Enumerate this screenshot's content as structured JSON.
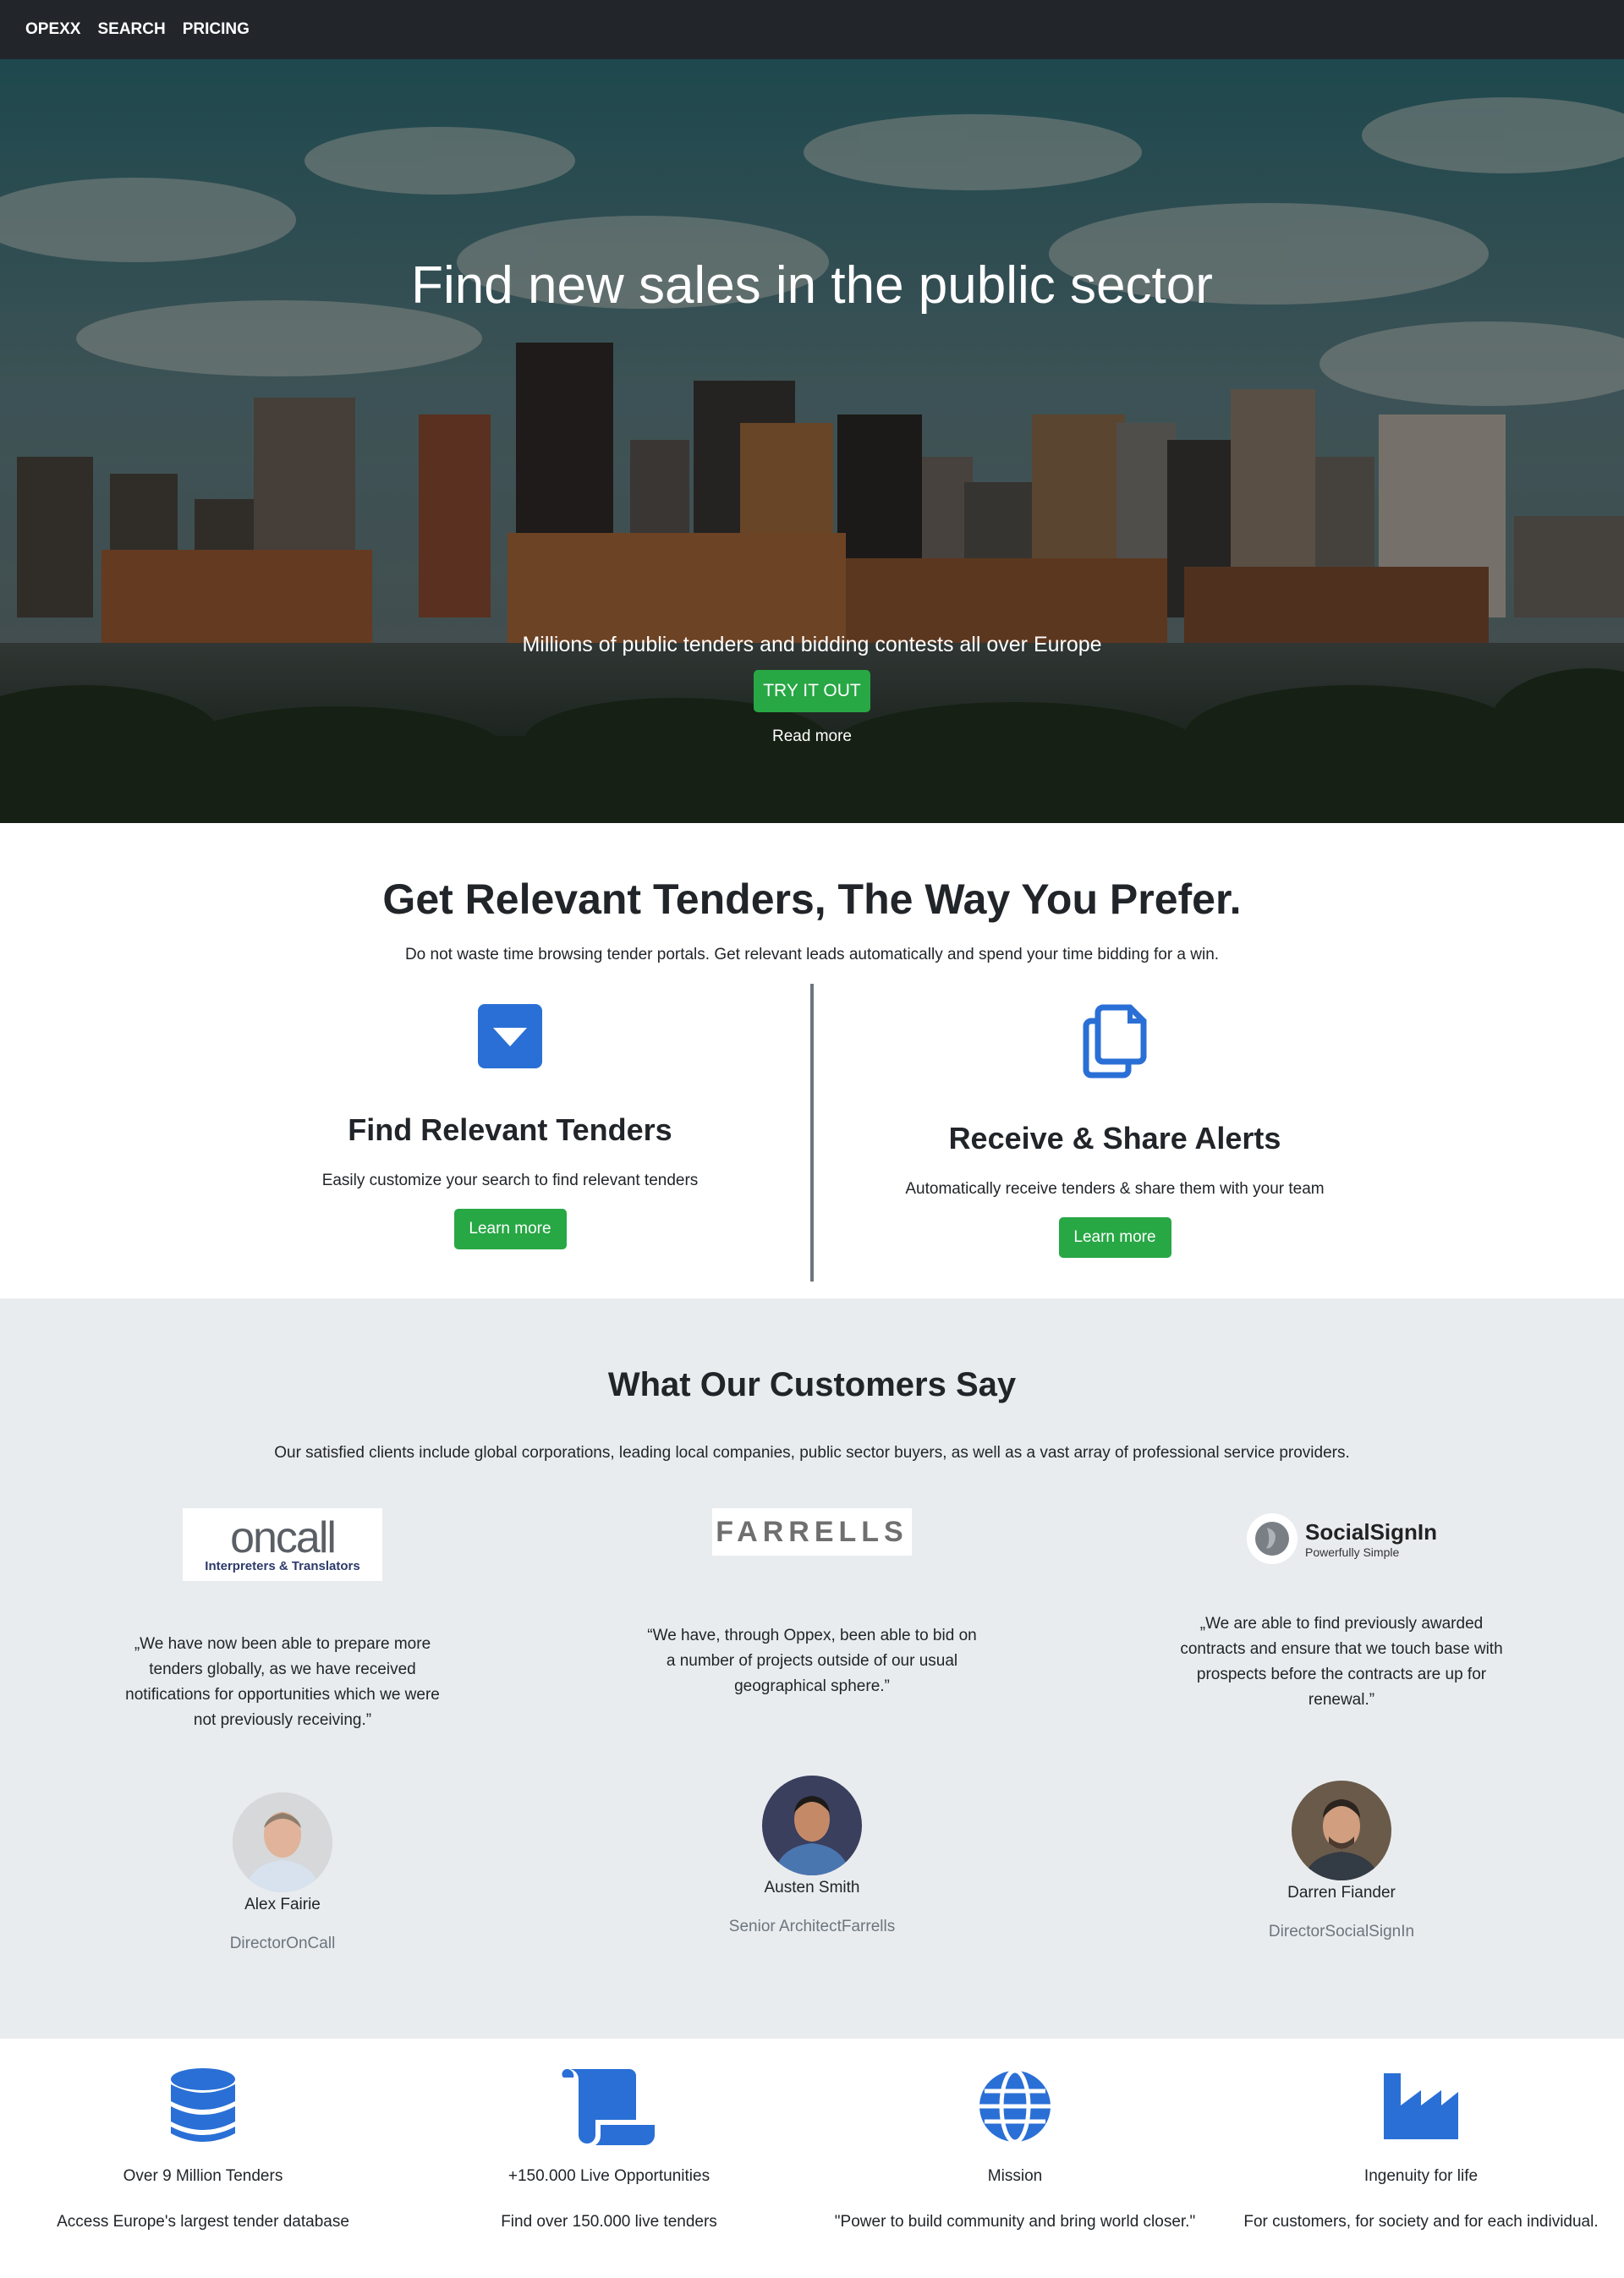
{
  "nav": {
    "brand": "OPEXX",
    "search": "SEARCH",
    "pricing": "PRICING"
  },
  "hero": {
    "title": "Find new sales in the public sector",
    "subtitle": "Millions of public tenders and bidding contests all over Europe",
    "cta": "TRY IT OUT",
    "read_more": "Read more"
  },
  "features": {
    "title": "Get Relevant Tenders, The Way You Prefer.",
    "subtitle": "Do not waste time browsing tender portals. Get relevant leads automatically and spend your time bidding for a win.",
    "items": [
      {
        "icon": "caret-down-square-icon",
        "heading": "Find Relevant Tenders",
        "text": "Easily customize your search to find relevant tenders",
        "button": "Learn more"
      },
      {
        "icon": "copy-icon",
        "heading": "Receive & Share Alerts",
        "text": "Automatically receive tenders & share them with your team",
        "button": "Learn more"
      }
    ]
  },
  "testimonials": {
    "title": "What Our Customers Say",
    "subtitle": "Our satisfied clients include global corporations, leading local companies, public sector buyers, as well as a vast array of professional service providers.",
    "items": [
      {
        "logo_main": "oncall",
        "logo_sub": "Interpreters & Translators",
        "quote": "„We have now been able to prepare more tenders globally, as we have received notifications for opportunities which we were not previously receiving.”",
        "name": "Alex Fairie",
        "role": "DirectorOnCall"
      },
      {
        "logo_main": "FARRELLS",
        "quote": "“We have, through Oppex, been able to bid on a number of projects outside of our usual geographical sphere.”",
        "name": "Austen Smith",
        "role": "Senior ArchitectFarrells"
      },
      {
        "logo_main": "SocialSignIn",
        "logo_sub": "Powerfully Simple",
        "quote": "„We are able to find previously awarded contracts and ensure that we touch base with prospects before the contracts are up for renewal.”",
        "name": "Darren Fiander",
        "role": "DirectorSocialSignIn"
      }
    ]
  },
  "stats": [
    {
      "icon": "database-icon",
      "title": "Over 9 Million Tenders",
      "text": "Access Europe's largest tender database"
    },
    {
      "icon": "scroll-icon",
      "title": "+150.000 Live Opportunities",
      "text": "Find over 150.000 live tenders"
    },
    {
      "icon": "globe-icon",
      "title": "Mission",
      "text": "\"Power to build community and bring world closer.\""
    },
    {
      "icon": "industry-icon",
      "title": "Ingenuity for life",
      "text": "For customers, for society and for each individual."
    }
  ],
  "colors": {
    "nav_bg": "#22262b",
    "accent_green": "#28a745",
    "icon_blue": "#2a6fd6",
    "testimonial_bg": "#e9ecef",
    "muted": "#6c757d"
  }
}
